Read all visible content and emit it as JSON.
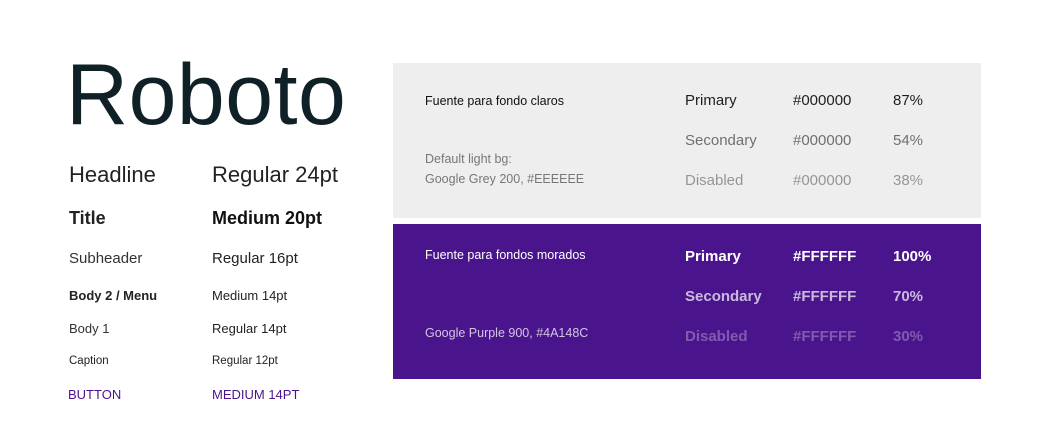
{
  "font_name": "Roboto",
  "type_scale": [
    {
      "name": "Headline",
      "spec": "Regular 24pt"
    },
    {
      "name": "Title",
      "spec": "Medium 20pt"
    },
    {
      "name": "Subheader",
      "spec": "Regular 16pt"
    },
    {
      "name": "Body 2 / Menu",
      "spec": "Medium 14pt"
    },
    {
      "name": "Body 1",
      "spec": "Regular 14pt"
    },
    {
      "name": "Caption",
      "spec": "Regular 12pt"
    },
    {
      "name": "BUTTON",
      "spec": "MEDIUM 14PT"
    }
  ],
  "light_panel": {
    "heading": "Fuente para fondo claros",
    "bg_line1": "Default light bg:",
    "bg_line2": "Google Grey 200, #EEEEEE",
    "background_color": "#EEEEEE",
    "rows": [
      {
        "label": "Primary",
        "hex": "#000000",
        "opacity": "87%"
      },
      {
        "label": "Secondary",
        "hex": "#000000",
        "opacity": "54%"
      },
      {
        "label": "Disabled",
        "hex": "#000000",
        "opacity": "38%"
      }
    ]
  },
  "dark_panel": {
    "heading": "Fuente para fondos morados",
    "bg_line": "Google Purple 900, #4A148C",
    "background_color": "#4A148C",
    "rows": [
      {
        "label": "Primary",
        "hex": "#FFFFFF",
        "opacity": "100%"
      },
      {
        "label": "Secondary",
        "hex": "#FFFFFF",
        "opacity": "70%"
      },
      {
        "label": "Disabled",
        "hex": "#FFFFFF",
        "opacity": "30%"
      }
    ]
  },
  "colors": {
    "title_text": "#0f2127",
    "button_text": "#4a148c"
  }
}
